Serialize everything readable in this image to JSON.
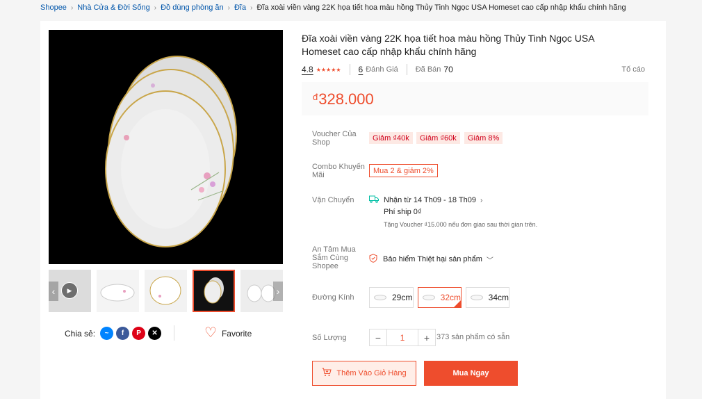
{
  "breadcrumb": [
    "Shopee",
    "Nhà Cửa & Đời Sống",
    "Đồ dùng phòng ăn",
    "Đĩa"
  ],
  "breadcrumb_current": "Đĩa xoài viền vàng 22K họa tiết hoa màu hồng Thủy Tinh Ngọc USA Homeset cao cấp nhập khẩu chính hãng",
  "product": {
    "title": "Đĩa xoài viền vàng 22K họa tiết hoa màu hồng Thủy Tinh Ngọc USA Homeset cao cấp nhập khẩu chính hãng",
    "rating": "4.8",
    "rating_value": 4.8,
    "reviews_count": "6",
    "reviews_label": "Đánh Giá",
    "sold_label": "Đã Bán",
    "sold_count": "70",
    "report_label": "Tố cáo",
    "currency": "đ",
    "price": "328.000"
  },
  "labels": {
    "voucher": "Voucher Của Shop",
    "combo": "Combo Khuyến Mãi",
    "shipping": "Vận Chuyển",
    "insurance": "An Tâm Mua Sắm Cùng Shopee",
    "diameter": "Đường Kính",
    "quantity": "Số Lượng"
  },
  "vouchers": [
    "Giảm ₫40k",
    "Giảm ₫60k",
    "Giảm 8%"
  ],
  "combo": "Mua 2 & giảm 2%",
  "shipping": {
    "delivery": "Nhận từ 14 Th09 - 18 Th09",
    "fee": "Phí ship 0₫",
    "note": "Tặng Voucher ₫15.000 nếu đơn giao sau thời gian trên."
  },
  "insurance": "Bảo hiểm Thiệt hại sản phẩm",
  "diameter_options": [
    "29cm",
    "32cm",
    "34cm"
  ],
  "selected_diameter": "32cm",
  "quantity": {
    "value": "1",
    "minus": "−",
    "plus": "+",
    "stock": "373 sản phẩm có sẵn"
  },
  "buttons": {
    "add_to_cart": "Thêm Vào Giỏ Hàng",
    "buy_now": "Mua Ngay"
  },
  "share_label": "Chia sẻ:",
  "favorite_label": "Favorite",
  "icons": [
    "messenger-icon",
    "facebook-icon",
    "pinterest-icon",
    "x-icon",
    "heart-icon",
    "truck-icon",
    "shield-icon",
    "cart-icon",
    "play-icon",
    "chevron-left-icon",
    "chevron-right-icon",
    "chevron-down-icon"
  ],
  "colors": {
    "accent": "#ee4d2d",
    "link": "#0055aa",
    "teal": "#00bfa5"
  }
}
